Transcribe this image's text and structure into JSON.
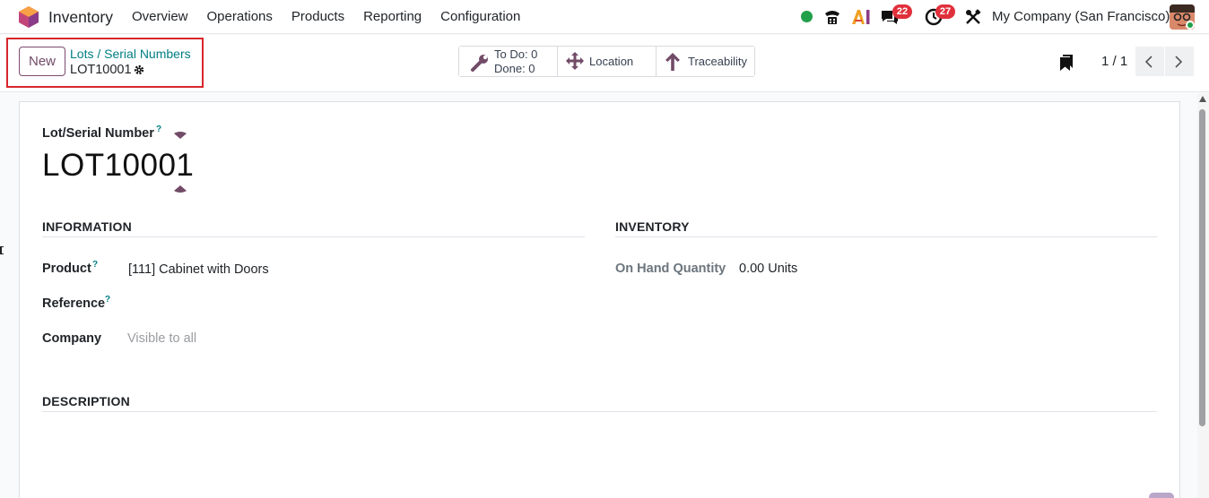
{
  "navbar": {
    "app_name": "Inventory",
    "menu": [
      "Overview",
      "Operations",
      "Products",
      "Reporting",
      "Configuration"
    ],
    "messages_count": "22",
    "activities_count": "27",
    "company": "My Company (San Francisco)",
    "icons": [
      "status-online-icon",
      "phone-icon",
      "ai-icon",
      "chat-icon",
      "clock-icon",
      "tools-icon"
    ]
  },
  "control_panel": {
    "new_label": "New",
    "breadcrumb_parent": "Lots / Serial Numbers",
    "breadcrumb_current": "LOT10001",
    "smart_buttons": {
      "todo": "To Do: 0",
      "done": "Done: 0",
      "location": "Location",
      "traceability": "Traceability"
    },
    "pager": "1 / 1"
  },
  "form": {
    "name_label": "Lot/Serial Number",
    "help_mark": "?",
    "name_value": "LOT10001",
    "information_title": "INFORMATION",
    "inventory_title": "INVENTORY",
    "description_title": "DESCRIPTION",
    "product_label": "Product",
    "product_value": "[111] Cabinet with Doors",
    "reference_label": "Reference",
    "company_label": "Company",
    "company_placeholder": "Visible to all",
    "on_hand_label": "On Hand Quantity",
    "on_hand_value": "0.00 Units"
  },
  "colors": {
    "primary": "#714b67",
    "link": "#017e84",
    "badge": "#e0303b",
    "online": "#21a04a",
    "highlight": "#d7262d"
  }
}
